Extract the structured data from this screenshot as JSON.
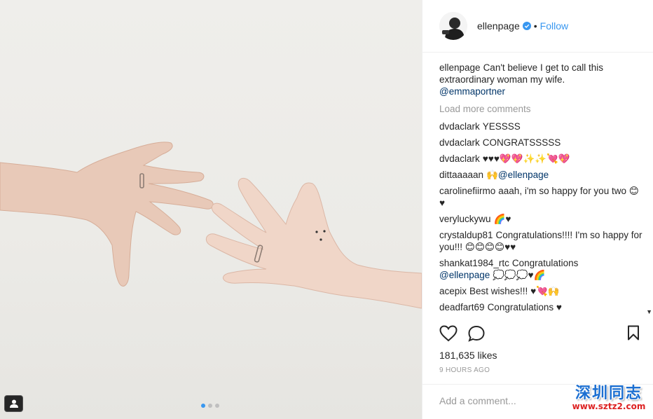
{
  "post": {
    "username": "ellenpage",
    "follow_label": "Follow",
    "bullet": "•",
    "caption_user": "ellenpage",
    "caption_text": "Can't believe I get to call this extraordinary woman my wife.",
    "caption_mention": "@emmaportner",
    "load_more": "Load more comments",
    "likes": "181,635 likes",
    "time": "9 HOURS AGO",
    "add_comment_placeholder": "Add a comment..."
  },
  "comments": [
    {
      "user": "dvdaclark",
      "text": "YESSSS",
      "mention": ""
    },
    {
      "user": "dvdaclark",
      "text": "CONGRATSSSSS",
      "mention": ""
    },
    {
      "user": "dvdaclark",
      "text": "♥♥♥💖💖✨✨💘💖",
      "mention": ""
    },
    {
      "user": "dittaaaaan",
      "text": "🙌",
      "mention": "@ellenpage"
    },
    {
      "user": "carolinefiirmo",
      "text": "aaah, i'm so happy for you two 😊♥",
      "mention": ""
    },
    {
      "user": "veryluckywu",
      "text": "🌈♥",
      "mention": ""
    },
    {
      "user": "crystaldup81",
      "text": "Congratulations!!!! I'm so happy for you!!! 😊😊😊😊♥♥",
      "mention": ""
    },
    {
      "user": "shankat1984_rtc",
      "text": "Congratulations",
      "mention": "@ellenpage",
      "after": "💭💭💭♥🌈"
    },
    {
      "user": "acepix",
      "text": "Best wishes!!! ♥💘🙌",
      "mention": ""
    },
    {
      "user": "deadfart69",
      "text": "Congratulations ♥",
      "mention": ""
    }
  ],
  "watermark": {
    "chinese": "深圳同志",
    "url": "www.sztz2.com"
  },
  "colors": {
    "link_blue": "#3897f0",
    "mention_blue": "#003569",
    "muted_gray": "#999999"
  },
  "icons": [
    "verified-badge-icon",
    "heart-icon",
    "comment-icon",
    "bookmark-icon",
    "tag-people-icon"
  ],
  "carousel": {
    "count": 3,
    "active": 1
  }
}
